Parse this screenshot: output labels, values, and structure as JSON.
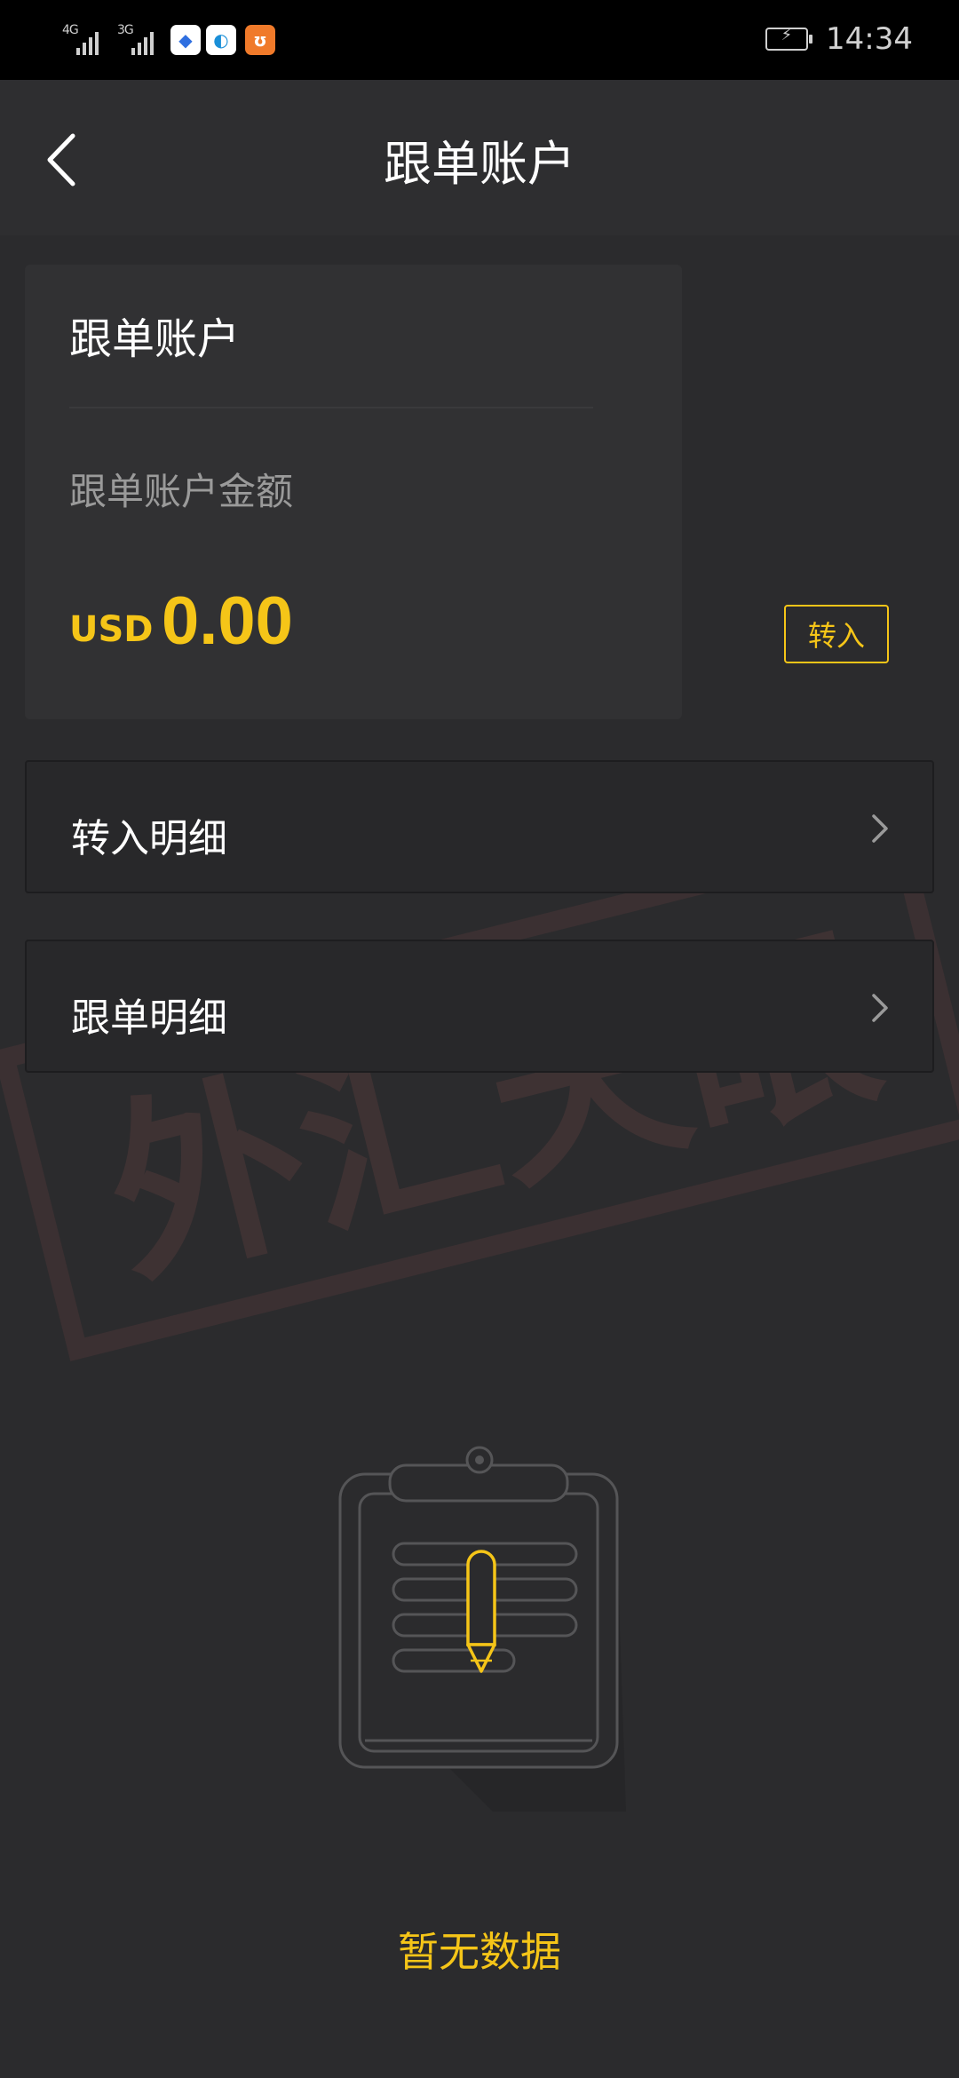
{
  "status_bar": {
    "network_1": "4G",
    "network_2": "3G",
    "time": "14:34",
    "apps": [
      {
        "icon": "baidu-app-icon",
        "color": "#2f6fe0"
      },
      {
        "icon": "browser-app-icon",
        "color": "#1a8fd8"
      },
      {
        "icon": "uc-browser-app-icon",
        "color": "#f07a2a"
      }
    ]
  },
  "header": {
    "title": "跟单账户"
  },
  "account_card": {
    "title": "跟单账户",
    "amount_label": "跟单账户金额",
    "currency": "USD",
    "amount": "0.00",
    "transfer_button": "转入"
  },
  "rows": [
    {
      "label": "转入明细"
    },
    {
      "label": "跟单明细"
    }
  ],
  "watermark": {
    "text": "外汇天眼"
  },
  "empty_state": {
    "message": "暂无数据"
  },
  "colors": {
    "accent": "#f5c518",
    "background": "#2b2b2d",
    "card": "#313133",
    "row": "#28282a"
  }
}
